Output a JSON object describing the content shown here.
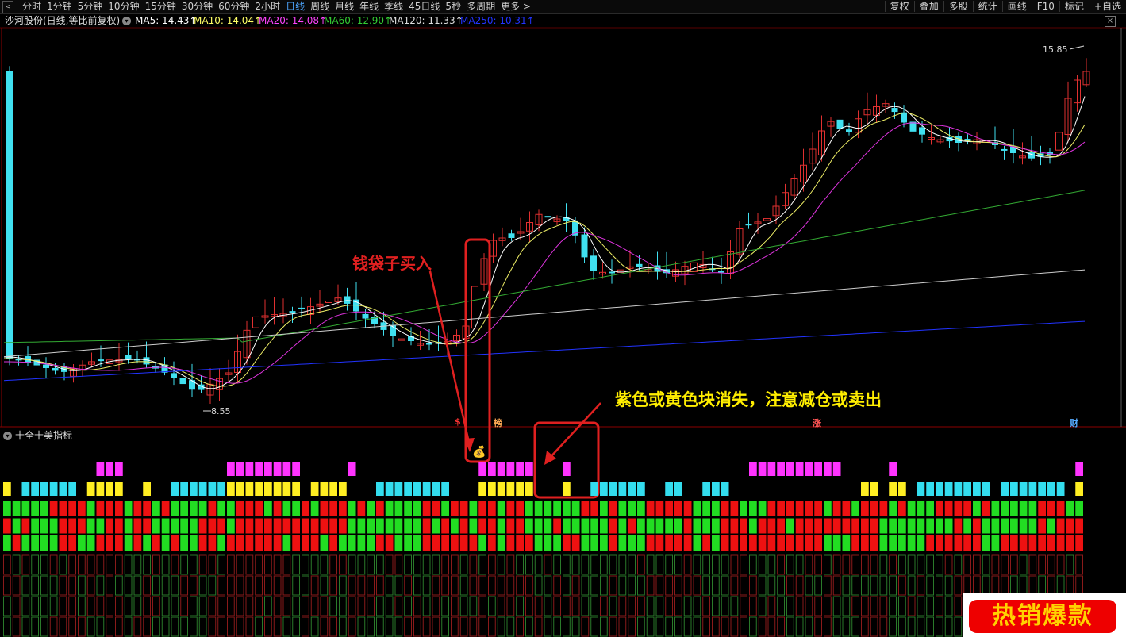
{
  "toolbar": {
    "periods": [
      "分时",
      "1分钟",
      "5分钟",
      "10分钟",
      "15分钟",
      "30分钟",
      "60分钟",
      "2小时",
      "日线",
      "周线",
      "月线",
      "年线",
      "季线",
      "45日线",
      "5秒",
      "多周期",
      "更多 >"
    ],
    "active_period": "日线",
    "tools": [
      "复权",
      "叠加",
      "多股",
      "统计",
      "画线",
      "F10",
      "标记",
      "+自选"
    ]
  },
  "info": {
    "stock": "沙河股份(日线,等比前复权)",
    "ma": [
      {
        "label": "MA5: 14.43",
        "color": "#ffffff"
      },
      {
        "label": "MA10: 14.04",
        "color": "#ffff66"
      },
      {
        "label": "MA20: 14.08",
        "color": "#ff44ff"
      },
      {
        "label": "MA60: 12.90",
        "color": "#33cc33"
      },
      {
        "label": "MA120: 11.33",
        "color": "#dddddd"
      },
      {
        "label": "MA250: 10.31",
        "color": "#2233ff"
      }
    ]
  },
  "chart_labels": {
    "high": "15.85",
    "low": "8.55"
  },
  "markers": {
    "tag1": "$",
    "tag2": "榜",
    "tag3": "涨",
    "tag4": "财"
  },
  "annotations": {
    "buy_text": "钱袋子买入",
    "sell_text": "紫色或黄色块消失，注意减仓或卖出",
    "buy_icon": "money-bag-icon"
  },
  "indicator": {
    "title": "十全十美指标"
  },
  "badge": {
    "text": "热销爆款"
  },
  "colors": {
    "up": "#e03030",
    "down": "#40e0f0",
    "magenta": "#ff33ff",
    "cyan": "#33ddee",
    "yellow": "#ffee22",
    "green": "#22dd22",
    "red": "#ee1111",
    "annot": "#e02020",
    "annot_yellow": "#ffee00"
  },
  "chart_data": {
    "type": "candlestick",
    "high_price": 15.85,
    "low_price": 8.55,
    "ma_values": {
      "MA5": 14.43,
      "MA10": 14.04,
      "MA20": 14.08,
      "MA60": 12.9,
      "MA120": 11.33,
      "MA250": 10.31
    }
  }
}
